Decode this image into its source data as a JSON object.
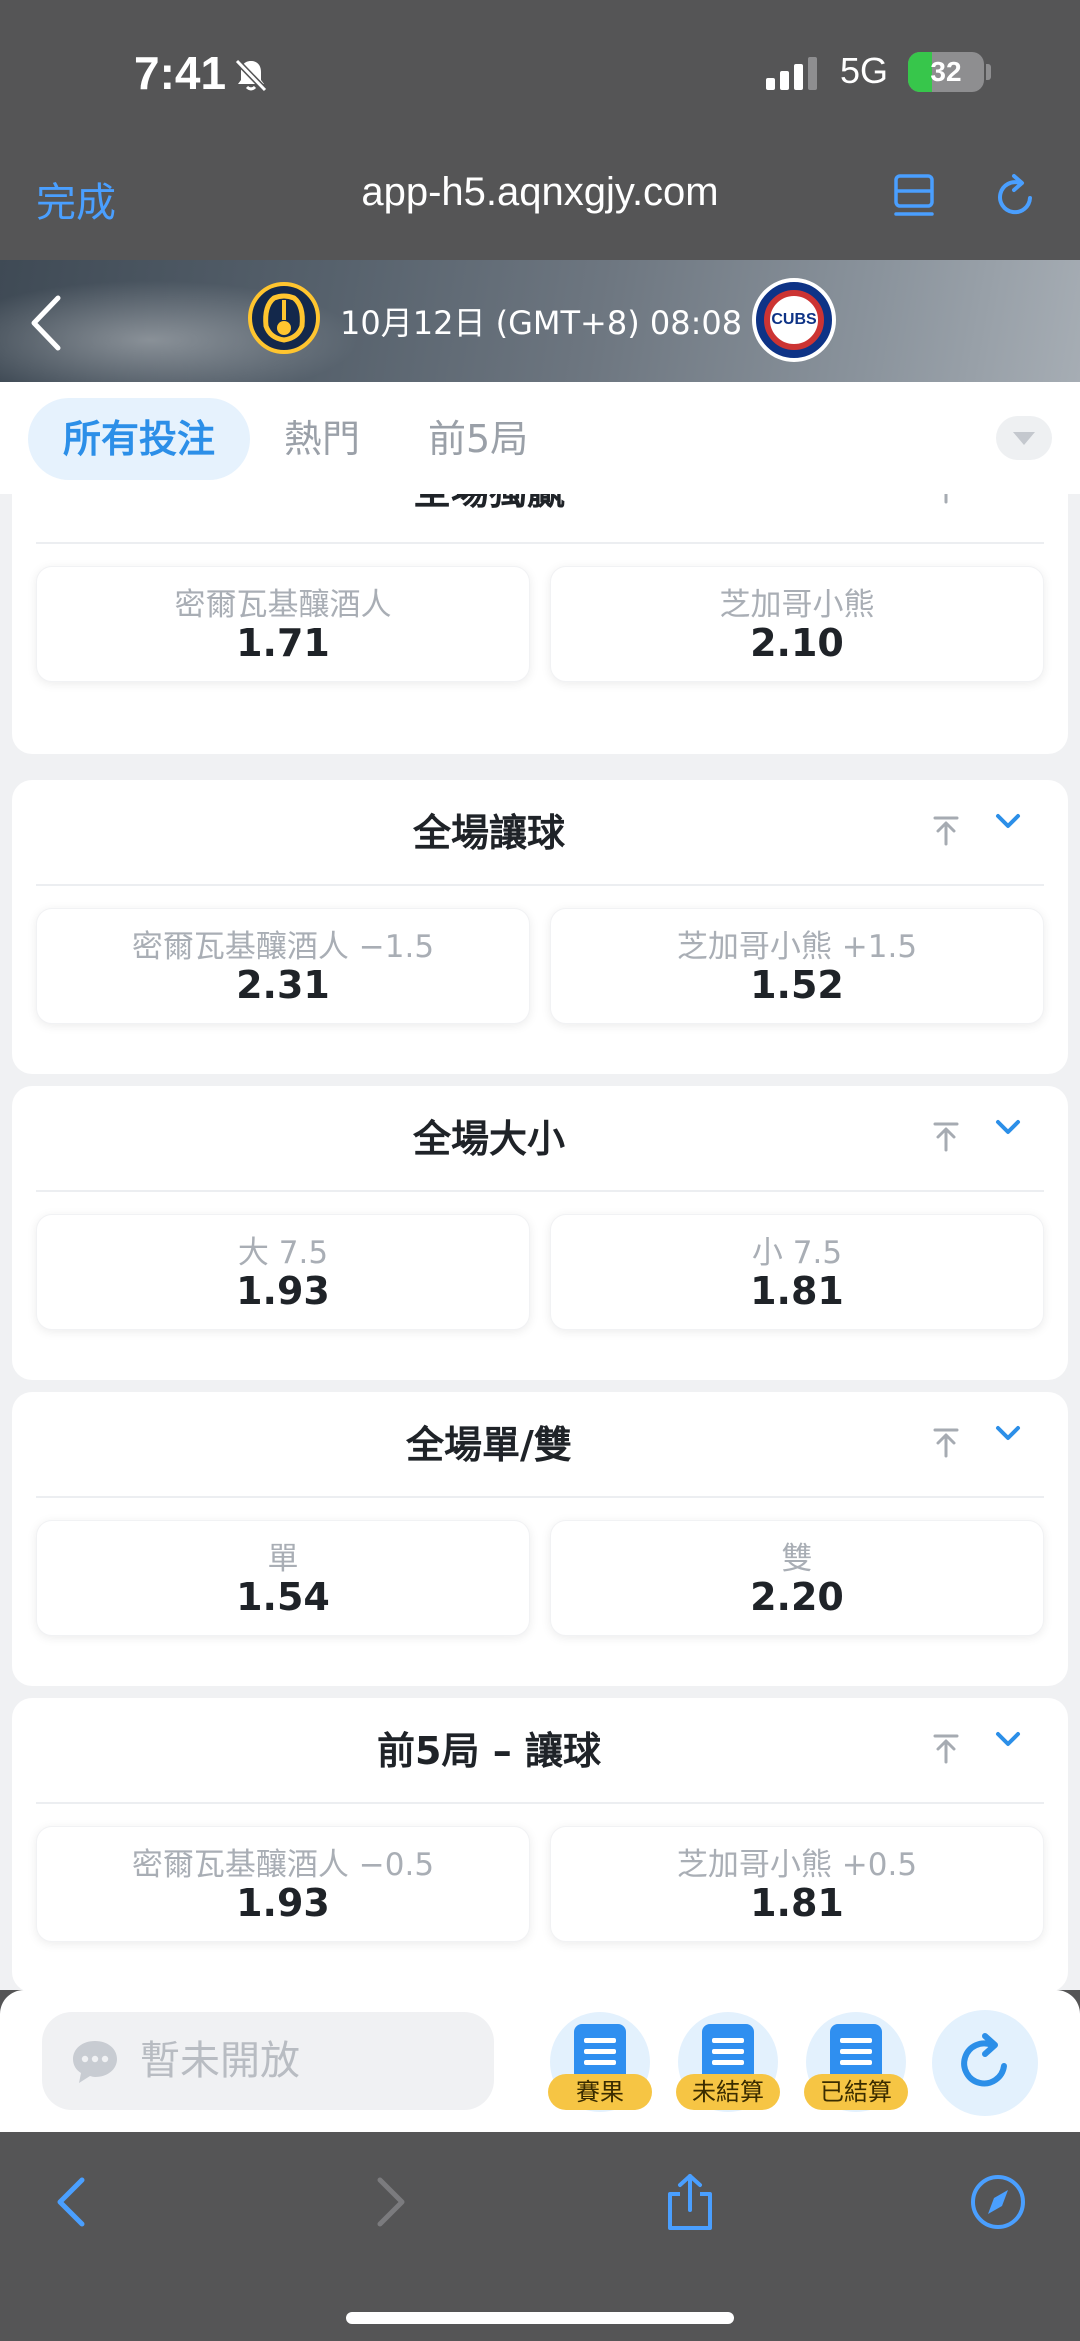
{
  "status_bar": {
    "time": "7:41",
    "network": "5G",
    "battery_level": "32",
    "battery_fraction": 0.32,
    "icons": [
      "bell-slash-icon",
      "signal-icon",
      "battery-icon"
    ]
  },
  "browser": {
    "done_label": "完成",
    "url": "app-h5.aqnxgjy.com",
    "icons": [
      "reader-icon",
      "reload-icon"
    ]
  },
  "match": {
    "datetime": "10月12日 (GMT+8)  08:08",
    "home_logo": "brewers-logo",
    "away_logo": "cubs-logo",
    "away_logo_text": "CUBS"
  },
  "tabs": [
    {
      "label": "所有投注",
      "active": true
    },
    {
      "label": "熱門",
      "active": false
    },
    {
      "label": "前5局",
      "active": false
    }
  ],
  "markets": [
    {
      "title": "全場獨贏",
      "options": [
        {
          "label": "密爾瓦基釀酒人",
          "odds": "1.71"
        },
        {
          "label": "芝加哥小熊",
          "odds": "2.10"
        }
      ]
    },
    {
      "title": "全場讓球",
      "options": [
        {
          "label": "密爾瓦基釀酒人 −1.5",
          "odds": "2.31"
        },
        {
          "label": "芝加哥小熊 +1.5",
          "odds": "1.52"
        }
      ]
    },
    {
      "title": "全場大小",
      "options": [
        {
          "label": "大 7.5",
          "odds": "1.93"
        },
        {
          "label": "小 7.5",
          "odds": "1.81"
        }
      ]
    },
    {
      "title": "全場單/雙",
      "options": [
        {
          "label": "單",
          "odds": "1.54"
        },
        {
          "label": "雙",
          "odds": "2.20"
        }
      ]
    },
    {
      "title": "前5局 – 讓球",
      "options": [
        {
          "label": "密爾瓦基釀酒人 −0.5",
          "odds": "1.93"
        },
        {
          "label": "芝加哥小熊 +0.5",
          "odds": "1.81"
        }
      ]
    }
  ],
  "action_bar": {
    "chat_placeholder": "暫未開放",
    "buttons": [
      {
        "label": "賽果",
        "icon": "results-doc-icon"
      },
      {
        "label": "未結算",
        "icon": "unsettled-calendar-icon"
      },
      {
        "label": "已結算",
        "icon": "settled-calendar-icon"
      }
    ],
    "refresh_icon": "refresh-icon"
  },
  "safari_toolbar": {
    "icons": [
      "back-arrow-icon",
      "forward-arrow-icon",
      "share-icon",
      "compass-icon"
    ]
  },
  "colors": {
    "accent": "#2c8fe8",
    "ios_blue": "#4a9fff",
    "badge_yellow": "#f6c544",
    "chrome_gray": "#555556"
  }
}
